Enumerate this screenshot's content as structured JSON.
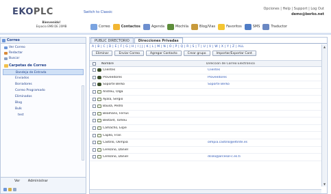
{
  "brand": {
    "logo_ek": "EKO",
    "logo_rest": "PLC"
  },
  "header": {
    "switch_link": "Switch to Classic",
    "top_links": "Opciones | Help | Support | Log Out",
    "user_email": "demo@berko.net",
    "welcome": "Bienvenido!",
    "space": "Espacio EMB DE 20MB"
  },
  "apps": [
    {
      "label": "Correo",
      "color": "#7aa3e0"
    },
    {
      "label": "Contactos",
      "color": "#f2b632"
    },
    {
      "label": "Agenda",
      "color": "#6d8fcf"
    },
    {
      "label": "Mochila",
      "color": "#5d8d3a"
    },
    {
      "label": "Blog/Vias",
      "color": "#c89a3b"
    },
    {
      "label": "Favoritos",
      "color": "#f4c531"
    },
    {
      "label": "SMS",
      "color": "#4f7cc6"
    },
    {
      "label": "Traductor",
      "color": "#6a88c3"
    }
  ],
  "sidebar": {
    "title": "Correo",
    "items": [
      "Ver Correo",
      "Redactar",
      "Buscar"
    ],
    "group": "Carpetas de Correo",
    "folders": [
      "Bandeja de Entrada",
      "Enviados",
      "Borradores",
      "Correo Programado",
      "Eliminados",
      "Blog",
      "Bulk",
      "test"
    ],
    "foot_links": [
      "Ver",
      "Administrar"
    ]
  },
  "main": {
    "tabs": [
      "PUBLIC DIRECTORIO",
      "Direcciones Privadas"
    ],
    "letters": "A | B | C | D | E | F | G | H | I | J | K | L | M | N | O | P | Q | R | S | T | U | V | W | X | Y | Z | ALL",
    "actions": [
      "Eliminar",
      "Enviar Correo",
      "Agregar Contacto",
      "Crear grupo",
      "Importar/Exportar Cont"
    ],
    "col_name": "Nombre",
    "col_email": "Dirección de Correo Electrónico",
    "rows": [
      {
        "name": "Clientes",
        "email": "Clientes",
        "type": "group"
      },
      {
        "name": "Proveedores",
        "email": "Proveedores",
        "type": "group"
      },
      {
        "name": "Soporte Berko",
        "email": "Soporte Berko",
        "type": "group"
      },
      {
        "name": "Andreu, Olga",
        "email": "",
        "type": "card"
      },
      {
        "name": "Ayala, Sergio",
        "email": "",
        "type": "card"
      },
      {
        "name": "Bausà, Pedro",
        "email": "",
        "type": "card"
      },
      {
        "name": "Beamans, Ferrus",
        "email": "",
        "type": "card"
      },
      {
        "name": "Bestard, Tomeu",
        "email": "",
        "type": "card"
      },
      {
        "name": "Camacho, Espe",
        "email": "",
        "type": "card"
      },
      {
        "name": "Capllo, Fran",
        "email": "",
        "type": "card"
      },
      {
        "name": "Castillo, Olimpia",
        "email": "olmpia.castillo@eltinte.es",
        "type": "card"
      },
      {
        "name": "Cerezino, Daniel",
        "email": "",
        "type": "card"
      },
      {
        "name": "Cerezino, Daniel",
        "email": "dcolo@arcesol-c.es.ti",
        "type": "card"
      }
    ]
  }
}
